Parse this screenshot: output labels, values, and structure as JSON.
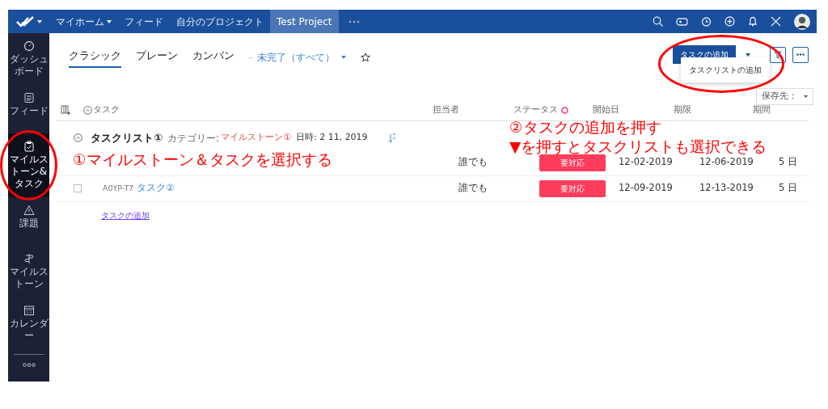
{
  "topbar": {
    "menu": [
      {
        "label": "マイホーム",
        "caret": true,
        "selected": false
      },
      {
        "label": "フィード",
        "caret": false,
        "selected": false
      },
      {
        "label": "自分のプロジェクト",
        "caret": false,
        "selected": false
      },
      {
        "label": "Test Project",
        "caret": false,
        "selected": true
      }
    ]
  },
  "sidebar": {
    "items": [
      {
        "kind": "dashboard",
        "label": "ダッシュボード",
        "selected": false
      },
      {
        "kind": "feed",
        "label": "フィード",
        "selected": false
      },
      {
        "kind": "tasks",
        "label": "マイルストーン&タスク",
        "selected": true
      },
      {
        "kind": "issues",
        "label": "課題",
        "selected": false
      },
      {
        "kind": "milestones",
        "label": "マイルストーン",
        "selected": false
      },
      {
        "kind": "calendar",
        "label": "カレンダー",
        "selected": false
      }
    ]
  },
  "views": [
    {
      "label": "クラシック",
      "selected": true
    },
    {
      "label": "プレーン",
      "selected": false
    },
    {
      "label": "カンバン",
      "selected": false
    }
  ],
  "separator": "-",
  "filter": "未完了（すべて）",
  "add_button": "タスクの追加",
  "dropdown_items": [
    "タスクリストの追加"
  ],
  "save_to": "保存先：",
  "columns": [
    "タスク",
    "担当者",
    "ステータス",
    "開始日",
    "期限",
    "期間"
  ],
  "group": {
    "title": "タスクリスト①",
    "category_label": "カテゴリー:",
    "category": "マイルストーン①",
    "date": "日時: 2 11, 2019"
  },
  "rows": [
    {
      "owner": "誰でも",
      "status": "要対応",
      "start": "12-02-2019",
      "due": "12-06-2019",
      "duration": "5 日"
    },
    {
      "checked": false,
      "key": "A0YP-T7",
      "name": "タスク②",
      "owner": "誰でも",
      "status": "要対応",
      "start": "12-09-2019",
      "due": "12-13-2019",
      "duration": "5 日"
    }
  ],
  "add_link": "タスクの追加",
  "annotations": [
    {
      "kind": "sidebar",
      "lines": [
        "①マイルストーン＆タスクを選択する"
      ]
    },
    {
      "kind": "button",
      "lines": [
        "②タスクの追加を押す",
        "▼を押すとタスクリストも選択できる"
      ]
    }
  ]
}
